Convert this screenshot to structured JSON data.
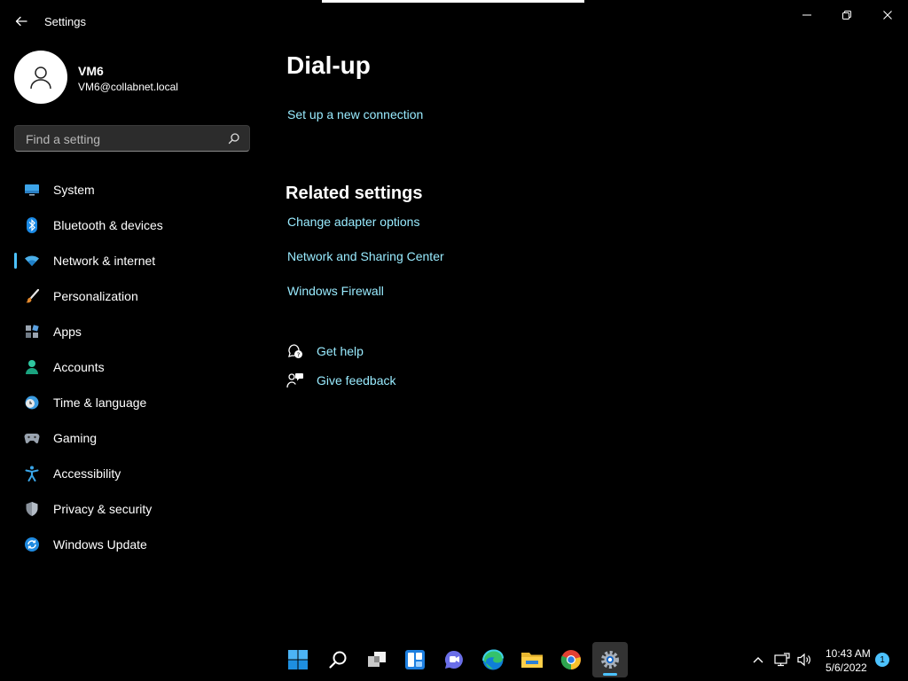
{
  "window": {
    "title": "Settings"
  },
  "profile": {
    "name": "VM6",
    "email": "VM6@collabnet.local"
  },
  "search": {
    "placeholder": "Find a setting"
  },
  "sidebar": {
    "items": [
      {
        "label": "System",
        "icon": "monitor-icon"
      },
      {
        "label": "Bluetooth & devices",
        "icon": "bluetooth-icon"
      },
      {
        "label": "Network & internet",
        "icon": "wifi-icon",
        "selected": true
      },
      {
        "label": "Personalization",
        "icon": "brush-icon"
      },
      {
        "label": "Apps",
        "icon": "apps-icon"
      },
      {
        "label": "Accounts",
        "icon": "person-icon"
      },
      {
        "label": "Time & language",
        "icon": "clock-globe-icon"
      },
      {
        "label": "Gaming",
        "icon": "gamepad-icon"
      },
      {
        "label": "Accessibility",
        "icon": "accessibility-icon"
      },
      {
        "label": "Privacy & security",
        "icon": "shield-icon"
      },
      {
        "label": "Windows Update",
        "icon": "update-icon"
      }
    ]
  },
  "main": {
    "title": "Dial-up",
    "setup_link": "Set up a new connection",
    "related_title": "Related settings",
    "related_links": [
      "Change adapter options",
      "Network and Sharing Center",
      "Windows Firewall"
    ],
    "help": {
      "get_help": "Get help",
      "give_feedback": "Give feedback"
    }
  },
  "taskbar": {
    "apps": [
      "windows-start-icon",
      "search-icon",
      "task-view-icon",
      "widgets-icon",
      "teams-chat-icon",
      "edge-icon",
      "file-explorer-icon",
      "chrome-icon",
      "settings-icon"
    ],
    "active_app": "settings-icon",
    "time": "10:43 AM",
    "date": "5/6/2022",
    "notification_count": "1"
  },
  "colors": {
    "accent": "#4cc2ff",
    "link": "#99ebff",
    "background": "#000000"
  }
}
